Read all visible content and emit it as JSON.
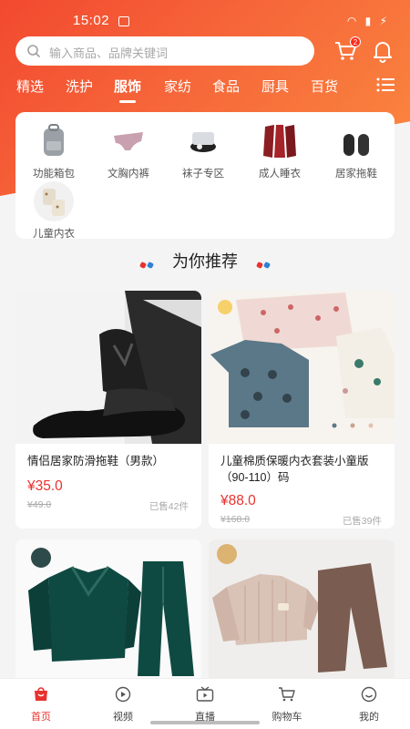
{
  "status": {
    "time": "15:02"
  },
  "search": {
    "placeholder": "输入商品、品牌关键词"
  },
  "cart": {
    "count": "2"
  },
  "categories": [
    "精选",
    "洗护",
    "服饰",
    "家纺",
    "食品",
    "厨具",
    "百货"
  ],
  "active_category": "服饰",
  "subcategories": [
    {
      "label": "功能箱包",
      "icon": "backpack-icon"
    },
    {
      "label": "文胸内裤",
      "icon": "underwear-icon"
    },
    {
      "label": "袜子专区",
      "icon": "socks-icon"
    },
    {
      "label": "成人睡衣",
      "icon": "pajamas-icon"
    },
    {
      "label": "居家拖鞋",
      "icon": "slippers-icon"
    },
    {
      "label": "儿童内衣",
      "icon": "kids-underwear-icon"
    }
  ],
  "recommend": {
    "title": "为你推荐"
  },
  "products": [
    {
      "name": "情侣居家防滑拖鞋（男款）",
      "price": "¥35.0",
      "original_price": "¥49.0",
      "sold": "已售42件"
    },
    {
      "name": "儿童棉质保暖内衣套装小童版（90-110）码",
      "price": "¥88.0",
      "original_price": "¥168.0",
      "sold": "已售39件"
    },
    {
      "name": "",
      "price": "",
      "original_price": "",
      "sold": "",
      "brand_mark": "SH"
    },
    {
      "name": "",
      "price": "",
      "original_price": "",
      "sold": "",
      "brand_mark": "SH"
    }
  ],
  "tabs": [
    {
      "label": "首页",
      "active": true
    },
    {
      "label": "视频"
    },
    {
      "label": "直播"
    },
    {
      "label": "购物车"
    },
    {
      "label": "我的"
    }
  ],
  "colors": {
    "accent": "#f2492f",
    "price": "#e8322e"
  }
}
